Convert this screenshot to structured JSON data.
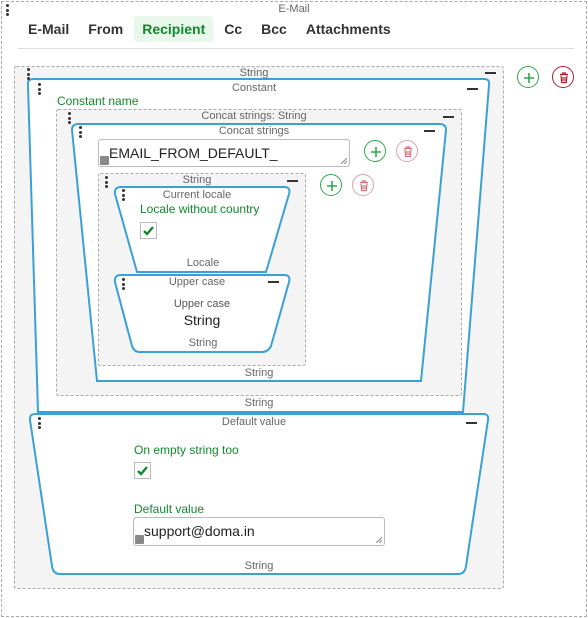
{
  "email_frame": {
    "title": "E-Mail"
  },
  "tabs": [
    {
      "label": "E-Mail",
      "active": false
    },
    {
      "label": "From",
      "active": false
    },
    {
      "label": "Recipient",
      "active": true
    },
    {
      "label": "Cc",
      "active": false
    },
    {
      "label": "Bcc",
      "active": false
    },
    {
      "label": "Attachments",
      "active": false
    }
  ],
  "outer_string": {
    "top_caption": "String"
  },
  "constant": {
    "title": "Constant",
    "field_label": "Constant name",
    "bottom_caption": "String"
  },
  "concat_group": {
    "top_caption": "Concat strings: String",
    "bottom_caption": "String"
  },
  "concat_block": {
    "title": "Concat strings",
    "input_value": "EMAIL_FROM_DEFAULT_",
    "bottom_caption": "String"
  },
  "string_group": {
    "top_caption": "String"
  },
  "current_locale": {
    "title": "Current locale",
    "option_label": "Locale without country",
    "checked": true,
    "bottom_caption": "Locale"
  },
  "upper_case": {
    "title": "Upper case",
    "inner_label": "Upper case",
    "inner_value": "String",
    "bottom_caption": "String"
  },
  "default_value": {
    "title": "Default value",
    "option_label": "On empty string too",
    "checked": true,
    "field_label": "Default value",
    "input_value": "support@doma.in",
    "bottom_caption": "String"
  },
  "colors": {
    "accent_green": "#11892a",
    "delete_red": "#b0202a",
    "block_blue": "#3aa0d6"
  },
  "icons": [
    "add-icon",
    "delete-icon",
    "drag-handle-icon",
    "collapse-icon",
    "checkmark-icon",
    "link-icon",
    "resize-handle-icon"
  ]
}
